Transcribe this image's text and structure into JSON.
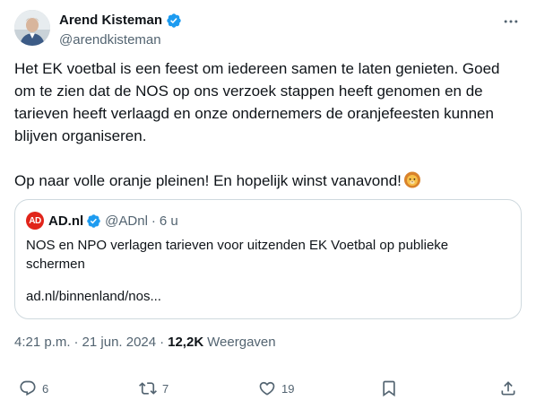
{
  "author": {
    "display_name": "Arend Kisteman",
    "handle": "@arendkisteman",
    "verified": true,
    "avatar_icon": "user-avatar-photo"
  },
  "tweet": {
    "text_line1": "Het EK voetbal is een feest om iedereen samen te laten genieten. Goed om te zien dat de NOS op ons verzoek stappen heeft genomen en de tarieven heeft verlaagd en onze ondernemers de oranjefeesten kunnen blijven organiseren.",
    "text_line2": "Op naar volle oranje pleinen! En hopelijk winst vanavond!",
    "emoji": "lion-face"
  },
  "quote": {
    "logo_text": "AD",
    "name": "AD.nl",
    "handle": "@ADnl",
    "dot": "·",
    "time": "6 u",
    "text": "NOS en NPO verlagen tarieven voor uitzenden EK Voetbal op publieke schermen",
    "url": "ad.nl/binnenland/nos..."
  },
  "meta": {
    "time": "4:21 p.m.",
    "dot1": "·",
    "date": "21 jun. 2024",
    "dot2": "·",
    "views_count": "12,2K",
    "views_label": "Weergaven"
  },
  "actions": {
    "reply_count": "6",
    "retweet_count": "7",
    "like_count": "19"
  },
  "colors": {
    "text_primary": "#0f1419",
    "text_secondary": "#536471",
    "verified_blue": "#1d9bf0",
    "border": "#cfd9de",
    "ad_red": "#e1241a"
  }
}
